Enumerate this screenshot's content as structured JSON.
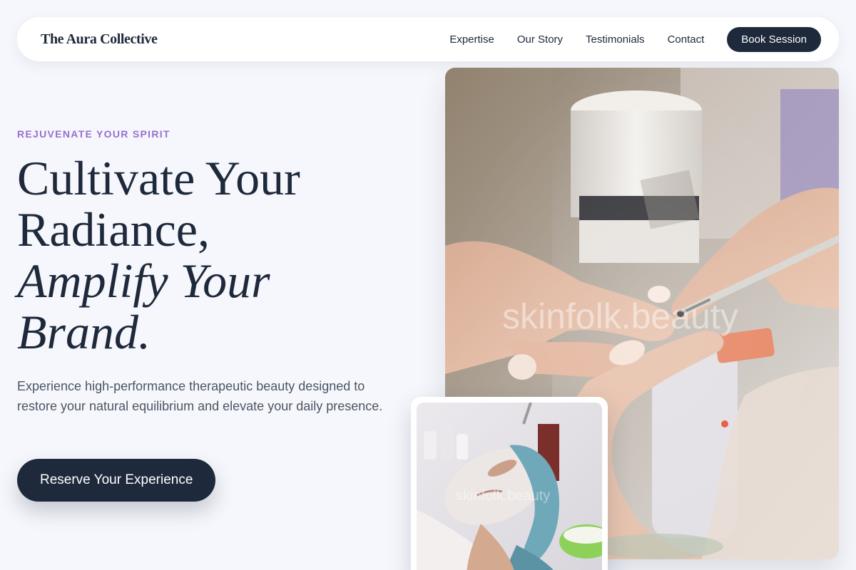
{
  "brand": {
    "name": "The Aura Collective"
  },
  "nav": {
    "links": [
      {
        "label": "Expertise"
      },
      {
        "label": "Our Story"
      },
      {
        "label": "Testimonials"
      },
      {
        "label": "Contact"
      }
    ],
    "cta_label": "Book Session"
  },
  "hero": {
    "eyebrow": "REJUVENATE YOUR SPIRIT",
    "headline_lines": [
      "Cultivate Your",
      "Radiance,",
      "Amplify Your",
      "Brand."
    ],
    "lead": "Experience high-performance therapeutic beauty designed to restore your natural equilibrium and elevate your daily presence.",
    "cta_label": "Reserve Your Experience"
  },
  "images": {
    "main_watermark": "skinfolk.beauty",
    "inset_watermark": "skinfolk.beauty"
  },
  "colors": {
    "page_background": "#f6f7fc",
    "primary_dark": "#1e293b",
    "eyebrow_accent": "#9a6fcf",
    "body_text": "#4b5563",
    "card_white": "#ffffff"
  },
  "icons": []
}
